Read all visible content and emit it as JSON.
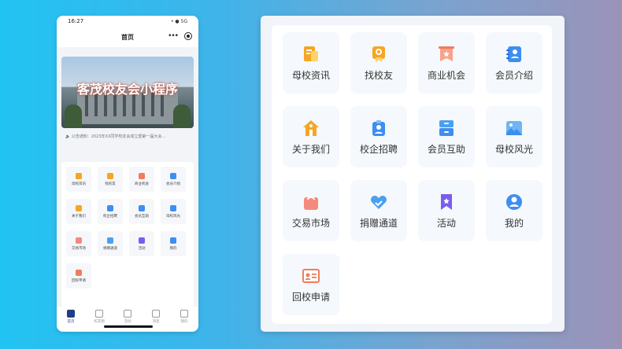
{
  "phone": {
    "status_time": "16:27",
    "status_right": "• ● 5G",
    "nav_title": "首页",
    "nav_more": "•••",
    "banner_title": "客茂校友会小程序",
    "notice": "🔈 公告通知：2023年XX同学校友会成立暨第一届大会...",
    "mini_items": [
      {
        "label": "母校资讯",
        "color": "#f5a623"
      },
      {
        "label": "找校友",
        "color": "#f5a623"
      },
      {
        "label": "商业机会",
        "color": "#f07c5b"
      },
      {
        "label": "会员介绍",
        "color": "#3d8ef0"
      },
      {
        "label": "关于我们",
        "color": "#f5a623"
      },
      {
        "label": "校企招聘",
        "color": "#3d8ef0"
      },
      {
        "label": "会员互助",
        "color": "#3d8ef0"
      },
      {
        "label": "母校风光",
        "color": "#3d8ef0"
      },
      {
        "label": "交易市场",
        "color": "#f48a7c"
      },
      {
        "label": "捐赠通道",
        "color": "#4aa0f0"
      },
      {
        "label": "活动",
        "color": "#7a5cf0"
      },
      {
        "label": "我的",
        "color": "#3d8ef0"
      },
      {
        "label": "回校申请",
        "color": "#f07c5b"
      }
    ],
    "tabs": [
      {
        "label": "首页",
        "active": true
      },
      {
        "label": "校友圈",
        "active": false
      },
      {
        "label": "活动",
        "active": false
      },
      {
        "label": "消息",
        "active": false
      },
      {
        "label": "我的",
        "active": false
      }
    ]
  },
  "panel": {
    "items": [
      {
        "label": "母校资讯",
        "icon": "news-icon"
      },
      {
        "label": "找校友",
        "icon": "badge-icon"
      },
      {
        "label": "商业机会",
        "icon": "banner-icon"
      },
      {
        "label": "会员介绍",
        "icon": "contacts-icon"
      },
      {
        "label": "关于我们",
        "icon": "house-icon"
      },
      {
        "label": "校企招聘",
        "icon": "id-badge-icon"
      },
      {
        "label": "会员互助",
        "icon": "cabinet-icon"
      },
      {
        "label": "母校风光",
        "icon": "landscape-icon"
      },
      {
        "label": "交易市场",
        "icon": "shopping-bag-icon"
      },
      {
        "label": "捐赠通道",
        "icon": "heart-hand-icon"
      },
      {
        "label": "活动",
        "icon": "bookmark-star-icon"
      },
      {
        "label": "我的",
        "icon": "user-circle-icon"
      },
      {
        "label": "回校申请",
        "icon": "id-card-icon"
      }
    ]
  }
}
